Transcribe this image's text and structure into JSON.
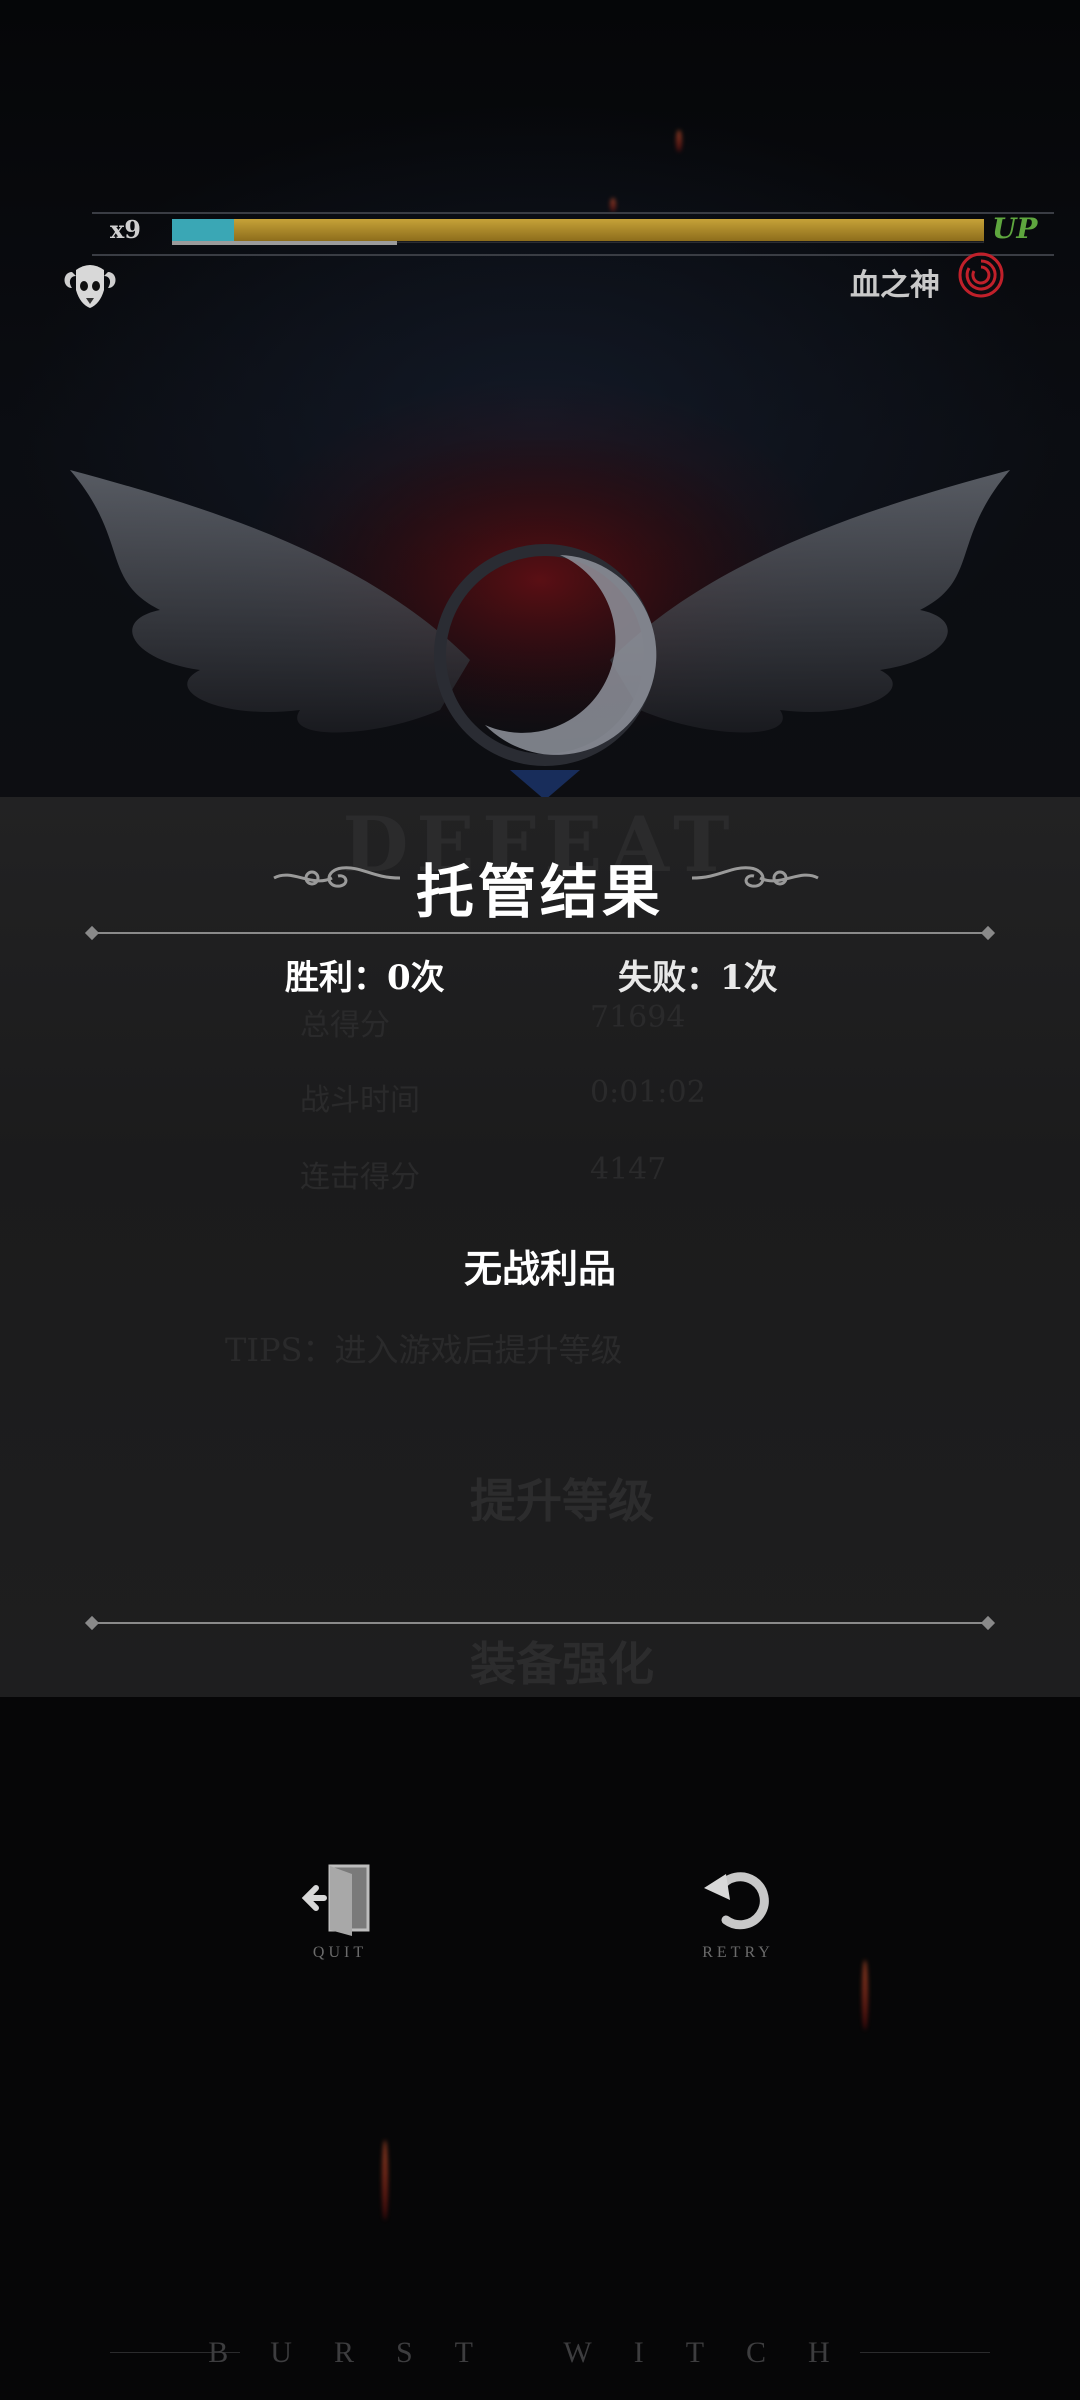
{
  "hud": {
    "level": "x9",
    "xp_progress": 1.0,
    "up_label": "UP",
    "god_name": "血之神"
  },
  "result": {
    "title": "托管结果",
    "win_label": "胜利：0次",
    "lose_label": "失败：1次",
    "loot_text": "无战利品"
  },
  "buttons": {
    "quit": "QUIT",
    "retry": "RETRY"
  },
  "footer": {
    "brand": "BURST WITCH"
  },
  "colors": {
    "xp_fill": "#c6a238",
    "up_green": "#5ea63e",
    "swirl_red": "#c0202a"
  }
}
